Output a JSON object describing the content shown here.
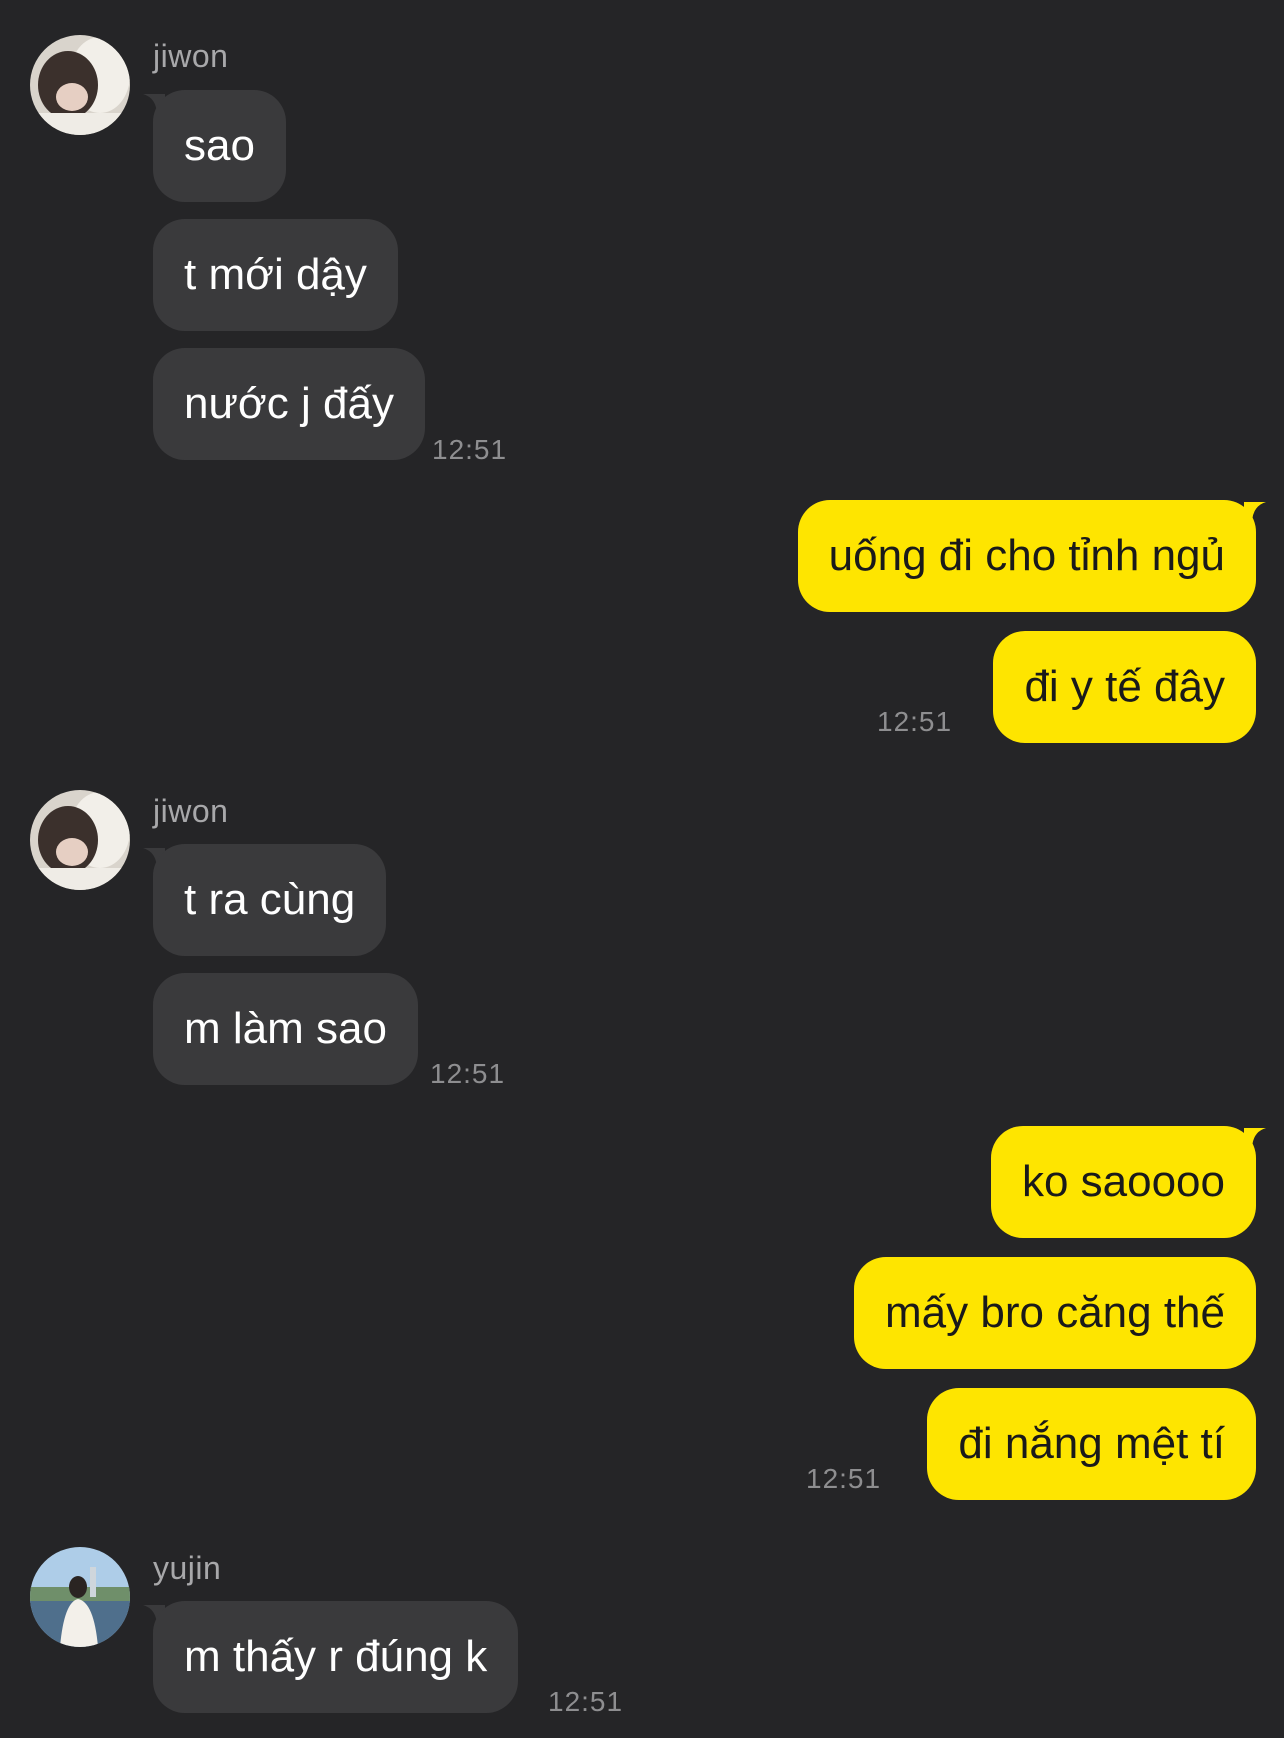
{
  "colors": {
    "background": "#252527",
    "incoming_bubble": "#3a3a3c",
    "outgoing_bubble": "#fee500",
    "name_text": "#a8a8aa",
    "time_text": "#8e8e90"
  },
  "groups": [
    {
      "direction": "incoming",
      "sender": "jiwon",
      "avatar": "profile-photo",
      "messages": [
        "sao",
        "t mới dậy",
        "nước j đấy"
      ],
      "time": "12:51"
    },
    {
      "direction": "outgoing",
      "messages": [
        "uống đi cho tỉnh ngủ",
        "đi y tế đây"
      ],
      "time": "12:51"
    },
    {
      "direction": "incoming",
      "sender": "jiwon",
      "avatar": "profile-photo",
      "messages": [
        "t ra cùng",
        "m làm sao"
      ],
      "time": "12:51"
    },
    {
      "direction": "outgoing",
      "messages": [
        "ko saoooo",
        "mấy bro căng thế",
        "đi nắng mệt tí"
      ],
      "time": "12:51"
    },
    {
      "direction": "incoming",
      "sender": "yujin",
      "avatar": "profile-photo",
      "messages": [
        "m thấy r đúng k"
      ],
      "time": "12:51"
    }
  ]
}
